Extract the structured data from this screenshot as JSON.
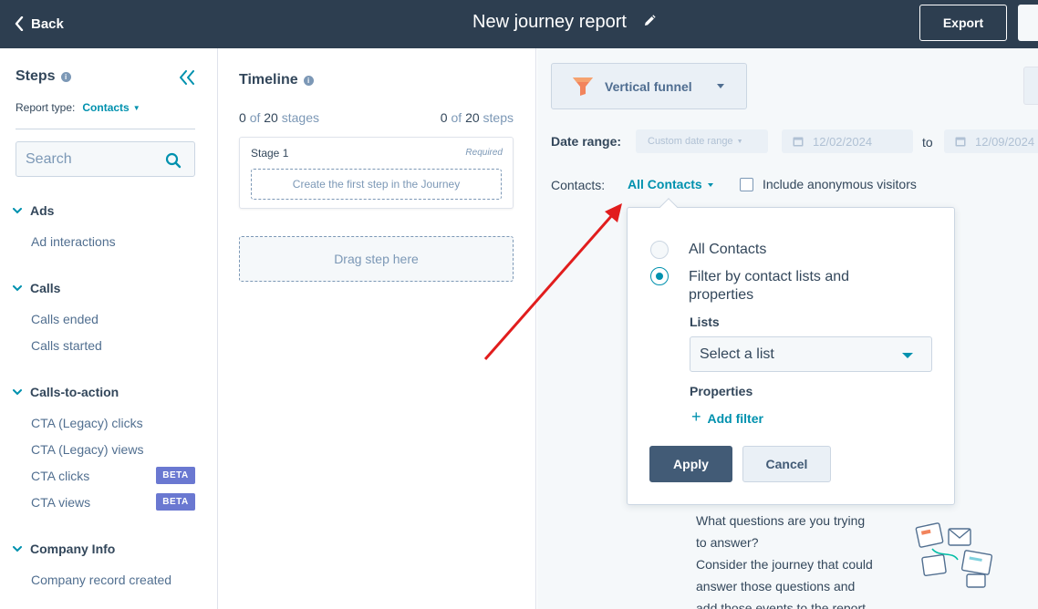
{
  "header": {
    "back_label": "Back",
    "title": "New journey report",
    "export_label": "Export"
  },
  "sidebar": {
    "title": "Steps",
    "report_type_label": "Report type:",
    "report_type_value": "Contacts",
    "search_placeholder": "Search",
    "groups": [
      {
        "label": "Ads",
        "items": [
          "Ad interactions"
        ]
      },
      {
        "label": "Calls",
        "items": [
          "Calls ended",
          "Calls started"
        ]
      },
      {
        "label": "Calls-to-action",
        "items": [
          "CTA (Legacy) clicks",
          "CTA (Legacy) views",
          "CTA clicks",
          "CTA views"
        ]
      },
      {
        "label": "Company Info",
        "items": [
          "Company record created"
        ]
      }
    ],
    "beta_label": "BETA"
  },
  "timeline": {
    "title": "Timeline",
    "stages_count": "0",
    "stages_of": "of",
    "stages_total": "20",
    "stages_word": "stages",
    "steps_count": "0",
    "steps_of": "of",
    "steps_total": "20",
    "steps_word": "steps",
    "stage_name": "Stage 1",
    "required_label": "Required",
    "first_step_placeholder": "Create the first step in the Journey",
    "drag_label": "Drag step here"
  },
  "main": {
    "chart_type": "Vertical funnel",
    "date_range_label": "Date range:",
    "date_range_value": "Custom date range",
    "start_date": "12/02/2024",
    "to_label": "to",
    "end_date": "12/09/2024",
    "contacts_label": "Contacts:",
    "contacts_value": "All Contacts",
    "anon_label": "Include anonymous visitors",
    "helper_lines": [
      "What questions are you trying",
      "to answer?",
      "Consider the journey that could",
      "answer those questions and",
      "add those events to the report"
    ]
  },
  "popover": {
    "option_all": "All Contacts",
    "option_filter": "Filter by contact lists and properties",
    "lists_label": "Lists",
    "list_placeholder": "Select a list",
    "properties_label": "Properties",
    "add_filter": "Add filter",
    "apply": "Apply",
    "cancel": "Cancel"
  },
  "colors": {
    "header_bg": "#2d3e50",
    "accent": "#0091ae",
    "beta": "#6a78d1",
    "annotation_arrow": "#e11d1d"
  }
}
